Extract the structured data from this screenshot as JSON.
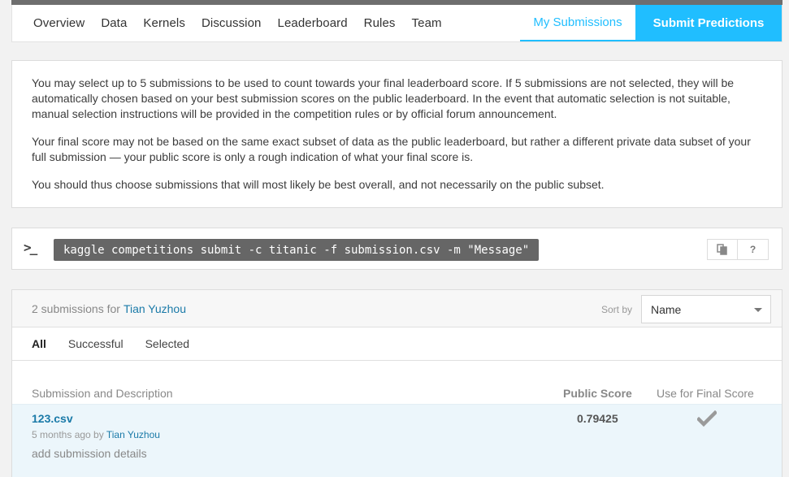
{
  "nav": {
    "tabs": [
      "Overview",
      "Data",
      "Kernels",
      "Discussion",
      "Leaderboard",
      "Rules",
      "Team"
    ],
    "my_submissions": "My Submissions",
    "submit_predictions": "Submit Predictions"
  },
  "info": {
    "p1": "You may select up to 5 submissions to be used to count towards your final leaderboard score. If 5 submissions are not selected, they will be automatically chosen based on your best submission scores on the public leaderboard. In the event that automatic selection is not suitable, manual selection instructions will be provided in the competition rules or by official forum announcement.",
    "p2": "Your final score may not be based on the same exact subset of data as the public leaderboard, but rather a different private data subset of your full submission — your public score is only a rough indication of what your final score is.",
    "p3": "You should thus choose submissions that will most likely be best overall, and not necessarily on the public subset."
  },
  "cli": {
    "prompt_icon": "terminal-prompt-icon",
    "command": "kaggle competitions submit -c titanic -f submission.csv -m \"Message\"",
    "copy_icon": "copy-icon",
    "help_label": "?"
  },
  "submissions": {
    "count_label": "2 submissions for",
    "user": "Tian Yuzhou",
    "sort_label": "Sort by",
    "sort_value": "Name",
    "filters": [
      "All",
      "Successful",
      "Selected"
    ],
    "columns": {
      "submission": "Submission and Description",
      "public_score": "Public Score",
      "final_score": "Use for Final Score"
    },
    "rows": [
      {
        "file": "123.csv",
        "age": "5 months ago by",
        "user": "Tian Yuzhou",
        "details": "add submission details",
        "score": "0.79425",
        "check_icon": "checkmark-icon"
      }
    ]
  },
  "colors": {
    "accent": "#20beff",
    "link": "#1a7aa8",
    "row_highlight": "#ecf6fb"
  }
}
